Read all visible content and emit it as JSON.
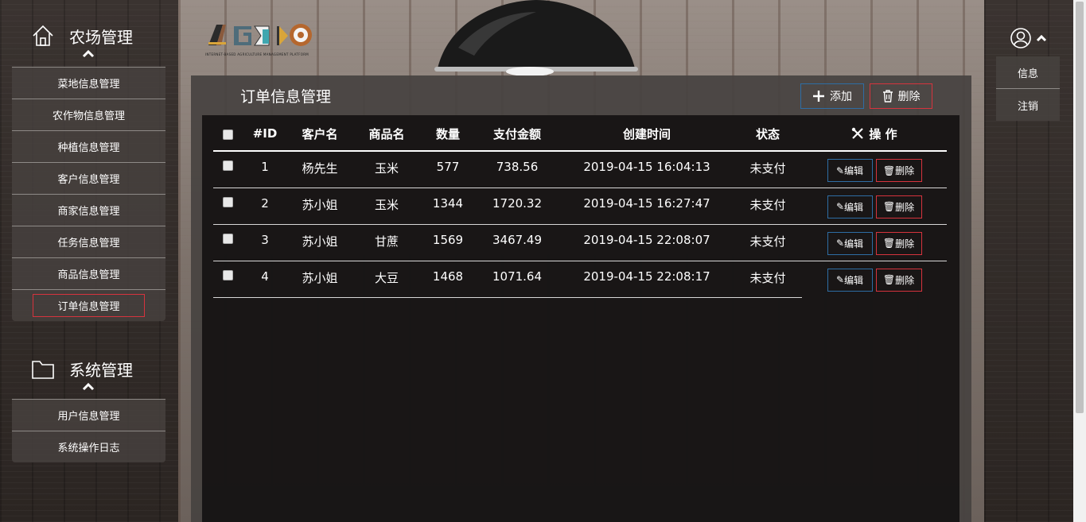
{
  "sidebar": {
    "farm_title": "农场管理",
    "farm_items": [
      {
        "label": "菜地信息管理"
      },
      {
        "label": "农作物信息管理"
      },
      {
        "label": "种植信息管理"
      },
      {
        "label": "客户信息管理"
      },
      {
        "label": "商家信息管理"
      },
      {
        "label": "任务信息管理"
      },
      {
        "label": "商品信息管理"
      },
      {
        "label": "订单信息管理",
        "active": true
      }
    ],
    "system_title": "系统管理",
    "system_items": [
      {
        "label": "用户信息管理"
      },
      {
        "label": "系统操作日志"
      }
    ]
  },
  "user_menu": {
    "info_label": "信息",
    "logout_label": "注销"
  },
  "logo": {
    "subtitle": "INTERNET-BASED AGRICULTURE MANAGEMENT PLATFORM"
  },
  "panel": {
    "title": "订单信息管理",
    "add_label": "添加",
    "delete_label": "删除"
  },
  "table": {
    "headers": {
      "id": "#ID",
      "customer": "客户名",
      "product": "商品名",
      "quantity": "数量",
      "amount": "支付金额",
      "created": "创建时间",
      "status": "状态",
      "actions": "操 作"
    },
    "edit_label": "编辑",
    "delete_label": "删除",
    "rows": [
      {
        "id": "1",
        "customer": "杨先生",
        "product": "玉米",
        "quantity": "577",
        "amount": "738.56",
        "created": "2019-04-15 16:04:13",
        "status": "未支付"
      },
      {
        "id": "2",
        "customer": "苏小姐",
        "product": "玉米",
        "quantity": "1344",
        "amount": "1720.32",
        "created": "2019-04-15 16:27:47",
        "status": "未支付"
      },
      {
        "id": "3",
        "customer": "苏小姐",
        "product": "甘蔗",
        "quantity": "1569",
        "amount": "3467.49",
        "created": "2019-04-15 22:08:07",
        "status": "未支付"
      },
      {
        "id": "4",
        "customer": "苏小姐",
        "product": "大豆",
        "quantity": "1468",
        "amount": "1071.64",
        "created": "2019-04-15 22:08:17",
        "status": "未支付"
      }
    ]
  },
  "colors": {
    "primary_border": "#2e6da4",
    "danger_border": "#d6333d"
  }
}
